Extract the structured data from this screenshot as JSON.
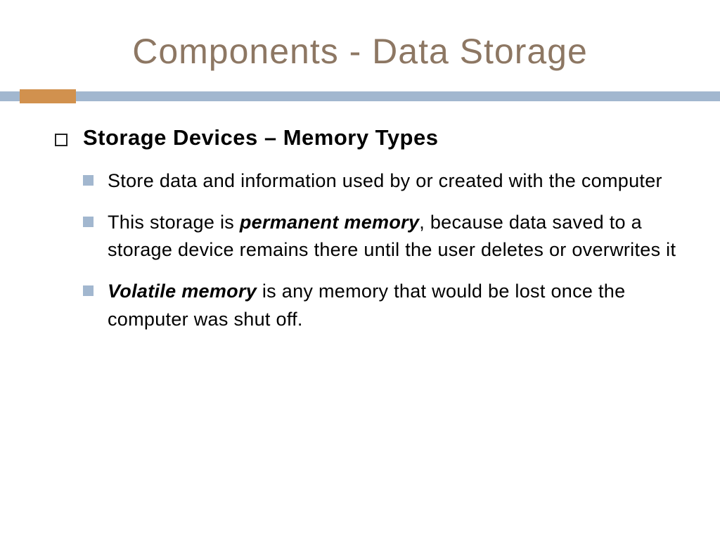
{
  "title": "Components - Data Storage",
  "heading": "Storage Devices – Memory Types",
  "bullets": {
    "b1": "Store data and information used by or created with the computer",
    "b2_pre": "This storage is ",
    "b2_em": "permanent memory",
    "b2_post": ", because data saved to a storage device remains there until the user deletes or overwrites it",
    "b3_em": "Volatile memory",
    "b3_post": " is any memory that would be lost once the computer was shut off."
  },
  "colors": {
    "title": "#8d7763",
    "accent_bar": "#a2b7cf",
    "accent_tab": "#d1914e"
  }
}
